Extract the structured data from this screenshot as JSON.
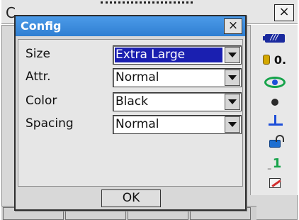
{
  "app": {
    "title_glyph": "C",
    "close_label": "×"
  },
  "status": {
    "offset_value": "0.",
    "count_value": "1",
    "count_prefix": "_"
  },
  "dialog": {
    "title": "Config",
    "close_label": "×",
    "fields": [
      {
        "label": "Size",
        "value": "Extra Large",
        "selected": true
      },
      {
        "label": "Attr.",
        "value": "Normal",
        "selected": false
      },
      {
        "label": "Color",
        "value": "Black",
        "selected": false
      },
      {
        "label": "Spacing",
        "value": "Normal",
        "selected": false
      }
    ],
    "ok_label": "OK"
  },
  "colors": {
    "title_bar": "#2f7fd2",
    "selection": "#1a1fb0",
    "battery": "#1a2a9e",
    "target": "#16a34a"
  }
}
